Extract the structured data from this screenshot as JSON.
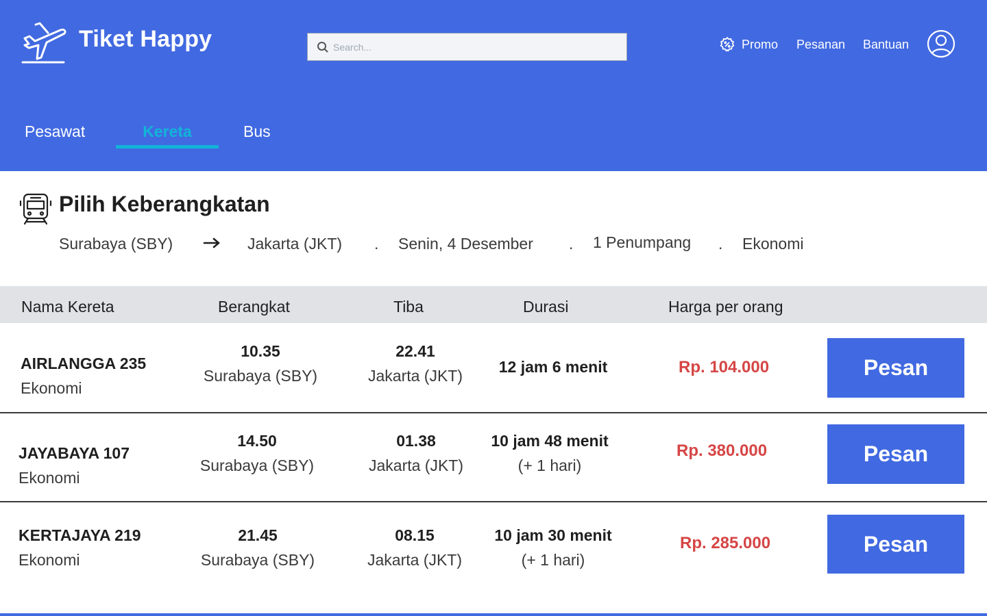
{
  "app": {
    "title": "Tiket Happy"
  },
  "header": {
    "brand": "Tiket Happy",
    "logo_icon": "airplane-departure-icon",
    "search_placeholder": "Search...",
    "nav": {
      "promo": "Promo",
      "pesanan": "Pesanan",
      "bantuan": "Bantuan"
    },
    "accent_color": "#4169e1"
  },
  "tabs": [
    {
      "label": "Pesawat",
      "active": false
    },
    {
      "label": "Kereta",
      "active": true
    },
    {
      "label": "Bus",
      "active": false
    }
  ],
  "page": {
    "title": "Pilih Keberangkatan",
    "origin": "Surabaya (SBY)",
    "destination": "Jakarta (JKT)",
    "date": "Senin, 4 Desember",
    "passengers": "1 Penumpang",
    "class": "Ekonomi",
    "separator": "."
  },
  "table": {
    "headers": {
      "name": "Nama Kereta",
      "depart": "Berangkat",
      "arrive": "Tiba",
      "duration": "Durasi",
      "price": "Harga per orang"
    },
    "rows": [
      {
        "name": "AIRLANGGA 235",
        "class": "Ekonomi",
        "depart_time": "10.35",
        "depart_station": "Surabaya (SBY)",
        "arrive_time": "22.41",
        "arrive_station": "Jakarta (JKT)",
        "duration": "12 jam 6 menit",
        "extra": "",
        "price": "Rp. 104.000",
        "button": "Pesan"
      },
      {
        "name": "JAYABAYA 107",
        "class": "Ekonomi",
        "depart_time": "14.50",
        "depart_station": "Surabaya (SBY)",
        "arrive_time": "01.38",
        "arrive_station": "Jakarta (JKT)",
        "duration": "10 jam 48 menit",
        "extra": "(+ 1 hari)",
        "price": "Rp. 380.000",
        "button": "Pesan"
      },
      {
        "name": "KERTAJAYA 219",
        "class": "Ekonomi",
        "depart_time": "21.45",
        "depart_station": "Surabaya (SBY)",
        "arrive_time": "08.15",
        "arrive_station": "Jakarta (JKT)",
        "duration": "10 jam 30 menit",
        "extra": "(+ 1 hari)",
        "price": "Rp. 285.000",
        "button": "Pesan"
      }
    ]
  },
  "colors": {
    "primary": "#4169e1",
    "active_tab": "#12b4d8",
    "price": "#d64545",
    "table_header_bg": "#e0e2e6"
  }
}
